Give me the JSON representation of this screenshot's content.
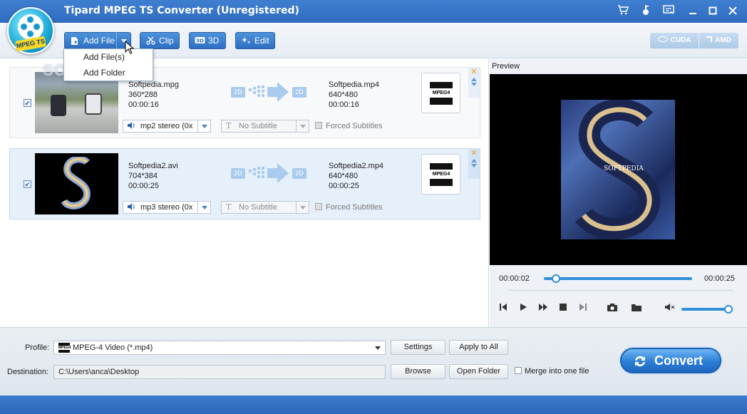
{
  "window": {
    "title": "Tipard MPEG TS Converter (Unregistered)",
    "logo_badge": "MPEG TS"
  },
  "toolbar": {
    "add_file_label": "Add File",
    "clip_label": "Clip",
    "threed_label": "3D",
    "edit_label": "Edit",
    "cuda_label": "CUDA",
    "amd_label": "AMD"
  },
  "add_menu": {
    "items": [
      "Add File(s)",
      "Add Folder"
    ]
  },
  "watermark": "SOFTPEDIA",
  "files": [
    {
      "source_name": "Softpedia.mpg",
      "source_res": "360*288",
      "source_duration": "00:00:16",
      "output_name": "Softpedia.mp4",
      "output_res": "640*480",
      "output_duration": "00:00:16",
      "audio": "mp2 stereo (0x",
      "subtitle": "No Subtitle",
      "forced_label": "Forced Subtitles",
      "badge_in": "2D",
      "badge_out": "2D",
      "format_label": "MPEG4",
      "checked": true
    },
    {
      "source_name": "Softpedia2.avi",
      "source_res": "704*384",
      "source_duration": "00:00:25",
      "output_name": "Softpedia2.mp4",
      "output_res": "640*480",
      "output_duration": "00:00:25",
      "audio": "mp3 stereo (0x",
      "subtitle": "No Subtitle",
      "forced_label": "Forced Subtitles",
      "badge_in": "2D",
      "badge_out": "2D",
      "format_label": "MPEG4",
      "checked": true
    }
  ],
  "preview": {
    "label": "Preview",
    "current_time": "00:00:02",
    "total_time": "00:00:25",
    "progress": 0.08,
    "volume": 1.0,
    "watermark": "SOFTPEDIA"
  },
  "bottom": {
    "profile_label": "Profile:",
    "profile_value": "MPEG-4 Video (*.mp4)",
    "profile_icon_text": "MPEG4",
    "settings_label": "Settings",
    "apply_all_label": "Apply to All",
    "destination_label": "Destination:",
    "destination_value": "C:\\Users\\anca\\Desktop",
    "browse_label": "Browse",
    "open_folder_label": "Open Folder",
    "merge_label": "Merge into one file",
    "convert_label": "Convert"
  },
  "colors": {
    "accent": "#2f6cc0",
    "selected_row": "#e6f0fb"
  }
}
